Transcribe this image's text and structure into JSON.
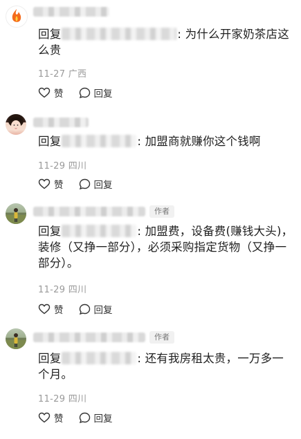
{
  "reply_prefix": "回复",
  "author_badge": "作者",
  "actions": {
    "like": "赞",
    "reply": "回复"
  },
  "comments": [
    {
      "text_after_mask": ": 为什么开家奶茶店这么贵",
      "date": "11-27",
      "location": "广西",
      "is_author": false,
      "avatar": "flame-logo"
    },
    {
      "text_after_mask": ": 加盟商就赚你这个钱啊",
      "date": "11-29",
      "location": "四川",
      "is_author": false,
      "avatar": "girl-photo"
    },
    {
      "text_after_mask": ": 加盟费，设备费(赚钱大头)，装修（又挣一部分），必须采购指定货物（又挣一部分）。",
      "date": "11-29",
      "location": "四川",
      "is_author": true,
      "avatar": "outdoor-photo"
    },
    {
      "text_after_mask": ": 还有我房租太贵，一万多一个月。",
      "date": "11-29",
      "location": "四川",
      "is_author": true,
      "avatar": "outdoor-photo"
    }
  ]
}
